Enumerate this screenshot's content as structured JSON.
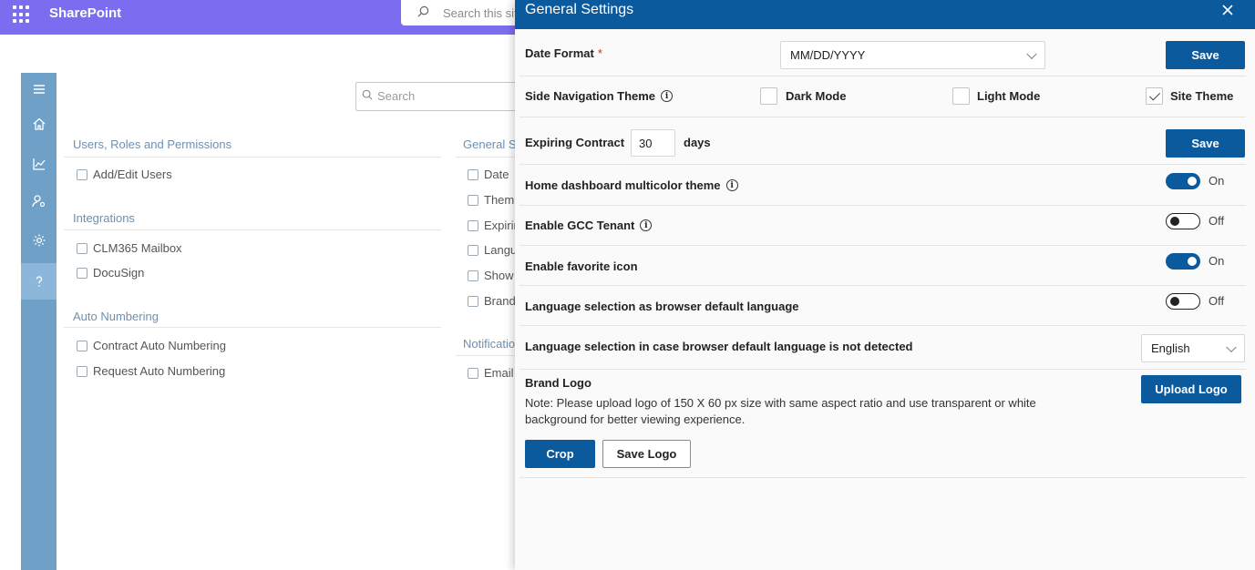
{
  "app": {
    "brand": "SharePoint",
    "search_placeholder": "Search this site"
  },
  "rail": {
    "items": [
      "menu-icon",
      "home-icon",
      "chart-icon",
      "user-settings-icon",
      "gear-icon",
      "help-icon"
    ],
    "active": "help-icon"
  },
  "settings_page": {
    "search_placeholder": "Search",
    "left_sections": [
      {
        "title": "Users, Roles and Permissions",
        "items": [
          "Add/Edit Users"
        ]
      },
      {
        "title": "Integrations",
        "items": [
          "CLM365 Mailbox",
          "DocuSign"
        ]
      },
      {
        "title": "Auto Numbering",
        "items": [
          "Contract Auto Numbering",
          "Request Auto Numbering"
        ]
      }
    ],
    "right_sections": [
      {
        "title": "General S",
        "items": [
          "Date",
          "Them",
          "Expirin",
          "Langu",
          "Show",
          "Brand"
        ]
      },
      {
        "title": "Notificatio",
        "items": [
          "Email"
        ]
      }
    ]
  },
  "panel": {
    "title": "General Settings",
    "date_format": {
      "label": "Date Format",
      "required_mark": "*",
      "value": "MM/DD/YYYY",
      "save_label": "Save"
    },
    "side_nav_theme": {
      "label": "Side Navigation Theme",
      "options": [
        {
          "label": "Dark Mode",
          "checked": false
        },
        {
          "label": "Light Mode",
          "checked": false
        },
        {
          "label": "Site Theme",
          "checked": true
        }
      ]
    },
    "expiring_contract": {
      "label": "Expiring Contract",
      "value": "30",
      "unit": "days",
      "save_label": "Save"
    },
    "home_multicolor": {
      "label": "Home dashboard multicolor theme",
      "state": "On",
      "on": true
    },
    "gcc_tenant": {
      "label": "Enable GCC Tenant",
      "state": "Off",
      "on": false
    },
    "favorite_icon": {
      "label": "Enable favorite icon",
      "state": "On",
      "on": true
    },
    "browser_language": {
      "label": "Language selection as browser default language",
      "state": "Off",
      "on": false
    },
    "fallback_language": {
      "label": "Language selection in case browser default language is not detected",
      "value": "English"
    },
    "brand_logo": {
      "label": "Brand Logo",
      "note_line1": "Note: Please upload logo of 150 X 60 px size with same aspect ratio and use transparent or white",
      "note_line2": "background for better viewing experience.",
      "upload_label": "Upload Logo",
      "crop_label": "Crop",
      "save_logo_label": "Save Logo"
    },
    "info_glyph": "i"
  },
  "colors": {
    "topbar": "#7b6cf0",
    "rail": "#6ea0c8",
    "panel_header": "#0b5a9e",
    "primary_button": "#0b5a9e"
  }
}
